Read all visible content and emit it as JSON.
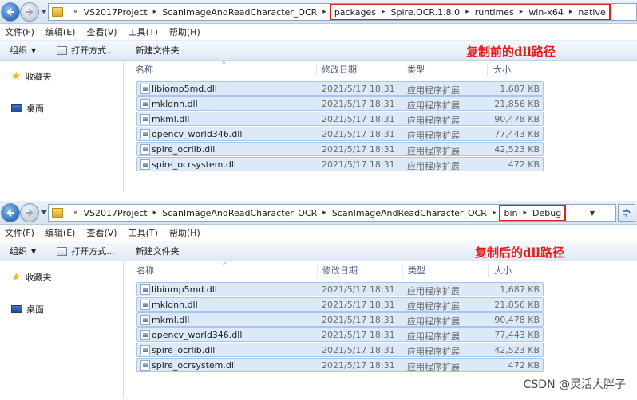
{
  "top": {
    "breadcrumbs": [
      "VS2017Project",
      "ScanImageAndReadCharacter_OCR"
    ],
    "highlighted_crumbs": [
      "packages",
      "Spire.OCR.1.8.0",
      "runtimes",
      "win-x64",
      "native"
    ],
    "menu": [
      "文件(F)",
      "编辑(E)",
      "查看(V)",
      "工具(T)",
      "帮助(H)"
    ],
    "toolbar": {
      "organize": "组织",
      "open_with": "打开方式...",
      "new_folder": "新建文件夹"
    },
    "annotation": "复制前的dll路径",
    "favorites": "收藏夹",
    "desktop": "桌面",
    "columns": {
      "name": "名称",
      "date": "修改日期",
      "type": "类型",
      "size": "大小"
    },
    "files": [
      {
        "name": "libiomp5md.dll",
        "date": "2021/5/17 18:31",
        "type": "应用程序扩展",
        "size": "1,687 KB"
      },
      {
        "name": "mkldnn.dll",
        "date": "2021/5/17 18:31",
        "type": "应用程序扩展",
        "size": "21,856 KB"
      },
      {
        "name": "mkml.dll",
        "date": "2021/5/17 18:31",
        "type": "应用程序扩展",
        "size": "90,478 KB"
      },
      {
        "name": "opencv_world346.dll",
        "date": "2021/5/17 18:31",
        "type": "应用程序扩展",
        "size": "77,443 KB"
      },
      {
        "name": "spire_ocrlib.dll",
        "date": "2021/5/17 18:31",
        "type": "应用程序扩展",
        "size": "42,523 KB"
      },
      {
        "name": "spire_ocrsystem.dll",
        "date": "2021/5/17 18:31",
        "type": "应用程序扩展",
        "size": "472 KB"
      }
    ]
  },
  "bottom": {
    "breadcrumbs": [
      "VS2017Project",
      "ScanImageAndReadCharacter_OCR",
      "ScanImageAndReadCharacter_OCR"
    ],
    "highlighted_crumbs": [
      "bin",
      "Debug"
    ],
    "menu": [
      "文件(F)",
      "编辑(E)",
      "查看(V)",
      "工具(T)",
      "帮助(H)"
    ],
    "toolbar": {
      "organize": "组织",
      "open_with": "打开方式...",
      "new_folder": "新建文件夹"
    },
    "annotation": "复制后的dll路径",
    "favorites": "收藏夹",
    "desktop": "桌面",
    "columns": {
      "name": "名称",
      "date": "修改日期",
      "type": "类型",
      "size": "大小"
    },
    "files": [
      {
        "name": "libiomp5md.dll",
        "date": "2021/5/17 18:31",
        "type": "应用程序扩展",
        "size": "1,687 KB"
      },
      {
        "name": "mkldnn.dll",
        "date": "2021/5/17 18:31",
        "type": "应用程序扩展",
        "size": "21,856 KB"
      },
      {
        "name": "mkml.dll",
        "date": "2021/5/17 18:31",
        "type": "应用程序扩展",
        "size": "90,478 KB"
      },
      {
        "name": "opencv_world346.dll",
        "date": "2021/5/17 18:31",
        "type": "应用程序扩展",
        "size": "77,443 KB"
      },
      {
        "name": "spire_ocrlib.dll",
        "date": "2021/5/17 18:31",
        "type": "应用程序扩展",
        "size": "42,523 KB"
      },
      {
        "name": "spire_ocrsystem.dll",
        "date": "2021/5/17 18:31",
        "type": "应用程序扩展",
        "size": "472 KB"
      }
    ]
  },
  "watermark": "CSDN @灵活大胖子",
  "colors": {
    "highlight_border": "#e0201b",
    "annotation": "#e0201b",
    "selection_fill": "#dce9f9",
    "selection_border": "#a9c6ea"
  }
}
